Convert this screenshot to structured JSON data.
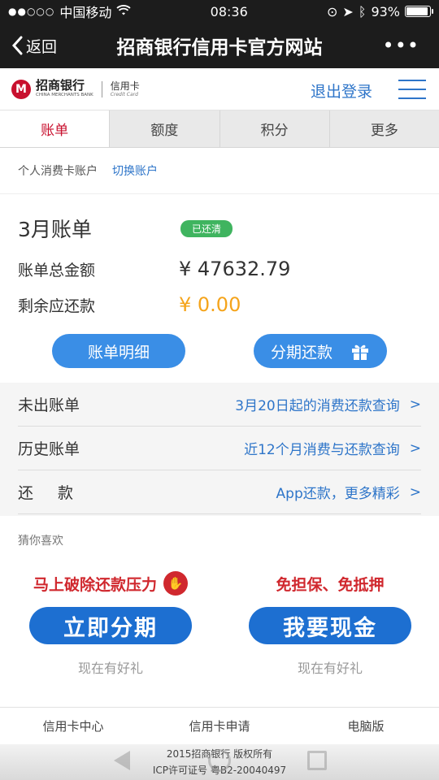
{
  "status": {
    "carrier": "中国移动",
    "time": "08:36",
    "battery": "93%",
    "battery_level": 0.93
  },
  "nav": {
    "back_label": "返回",
    "title": "招商银行信用卡官方网站",
    "more": "•••"
  },
  "brand": {
    "cn": "招商银行",
    "en": "CHINA MERCHANTS BANK",
    "card_cn": "信用卡",
    "card_en": "Credit Card",
    "logout": "退出登录"
  },
  "tabs": [
    "账单",
    "额度",
    "积分",
    "更多"
  ],
  "account": {
    "label": "个人消费卡账户",
    "switch": "切换账户"
  },
  "bill": {
    "month": "3月账单",
    "status_badge": "已还清",
    "total_label": "账单总金额",
    "total_value": "¥ 47632.79",
    "remaining_label": "剩余应还款",
    "remaining_value": "¥ 0.00",
    "detail_button": "账单明细",
    "installment_button": "分期还款"
  },
  "list": [
    {
      "label": "未出账单",
      "value": "3月20日起的消费还款查询",
      "arrow": ">"
    },
    {
      "label": "历史账单",
      "value": "近12个月消费与还款查询",
      "arrow": ">"
    },
    {
      "label": "还款",
      "value": "App还款，更多精彩",
      "arrow": ">"
    }
  ],
  "guess": {
    "title": "猜你喜欢",
    "left": {
      "headline": "马上破除还款压力",
      "button": "立即分期",
      "gift": "现在有好礼"
    },
    "right": {
      "headline": "免担保、免抵押",
      "button": "我要现金",
      "gift": "现在有好礼"
    }
  },
  "footer": {
    "links": [
      "信用卡中心",
      "信用卡申请",
      "电脑版"
    ],
    "copyright": "2015招商银行 版权所有",
    "icp": "ICP许可证号 粤B2-20040497"
  },
  "colors": {
    "brand_red": "#c8102e",
    "link_blue": "#2e75c9",
    "button_blue": "#3a8ee6",
    "paid_green": "#3fb45f",
    "amount_orange": "#f5a41b"
  }
}
